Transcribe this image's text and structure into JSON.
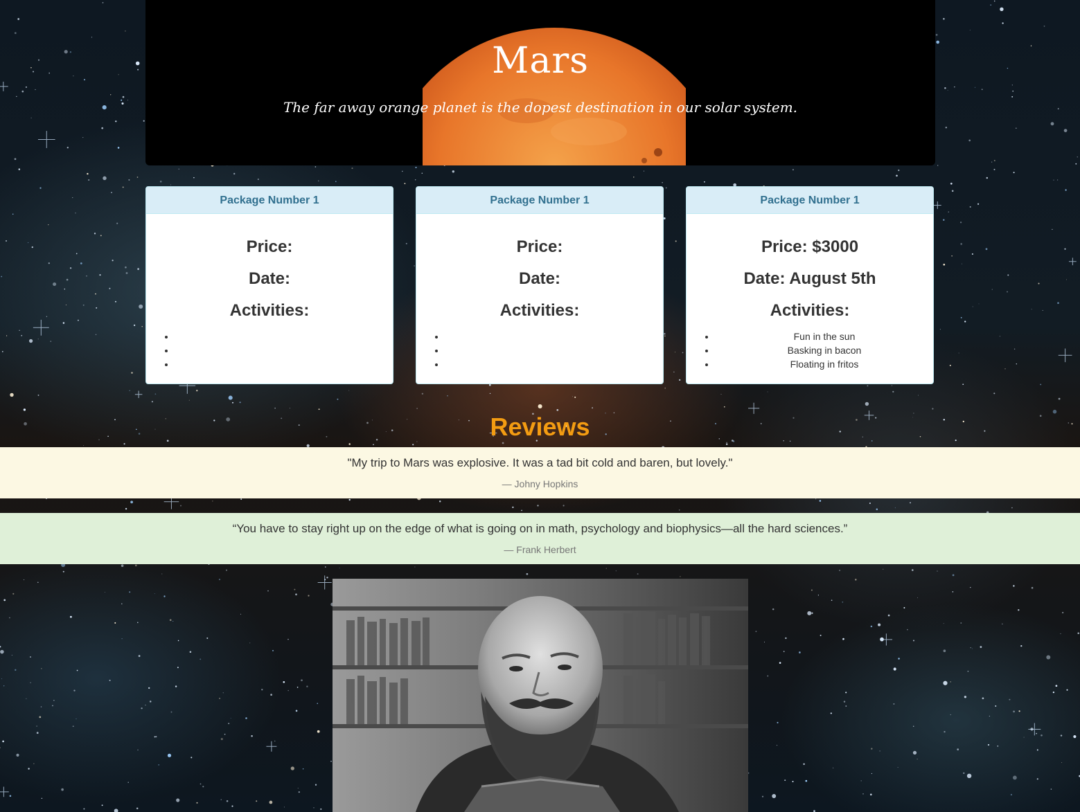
{
  "hero": {
    "title": "Mars",
    "subtitle": "The far away orange planet is the dopest destination in our solar system."
  },
  "packages": [
    {
      "heading": "Package Number 1",
      "price": "Price:",
      "date": "Date:",
      "activities_label": "Activities:",
      "activities": [
        "",
        "",
        ""
      ]
    },
    {
      "heading": "Package Number 1",
      "price": "Price:",
      "date": "Date:",
      "activities_label": "Activities:",
      "activities": [
        "",
        "",
        ""
      ]
    },
    {
      "heading": "Package Number 1",
      "price": "Price: $3000",
      "date": "Date: August 5th",
      "activities_label": "Activities:",
      "activities": [
        "Fun in the sun",
        "Basking in bacon",
        "Floating in fritos"
      ]
    }
  ],
  "reviews": {
    "heading": "Reviews",
    "items": [
      {
        "quote": "\"My trip to Mars was explosive. It was a tad bit cold and baren, but lovely.\"",
        "author": "— Johny Hopkins"
      },
      {
        "quote": "“You have to stay right up on the edge of what is going on in math, psychology and biophysics—all the hard sciences.”",
        "author": "— Frank Herbert"
      }
    ]
  },
  "colors": {
    "hero_bg": "#000000",
    "planet": "#e8762a",
    "panel_heading_bg": "#d9edf7",
    "panel_heading_text": "#31708f",
    "reviews_heading": "#f39c12",
    "review_1_bg": "#fcf8e3",
    "review_2_bg": "#dff0d8"
  },
  "images": {
    "portrait": "black-and-white-portrait-photo",
    "planet": "mars-planet-image",
    "background": "starfield-background"
  }
}
